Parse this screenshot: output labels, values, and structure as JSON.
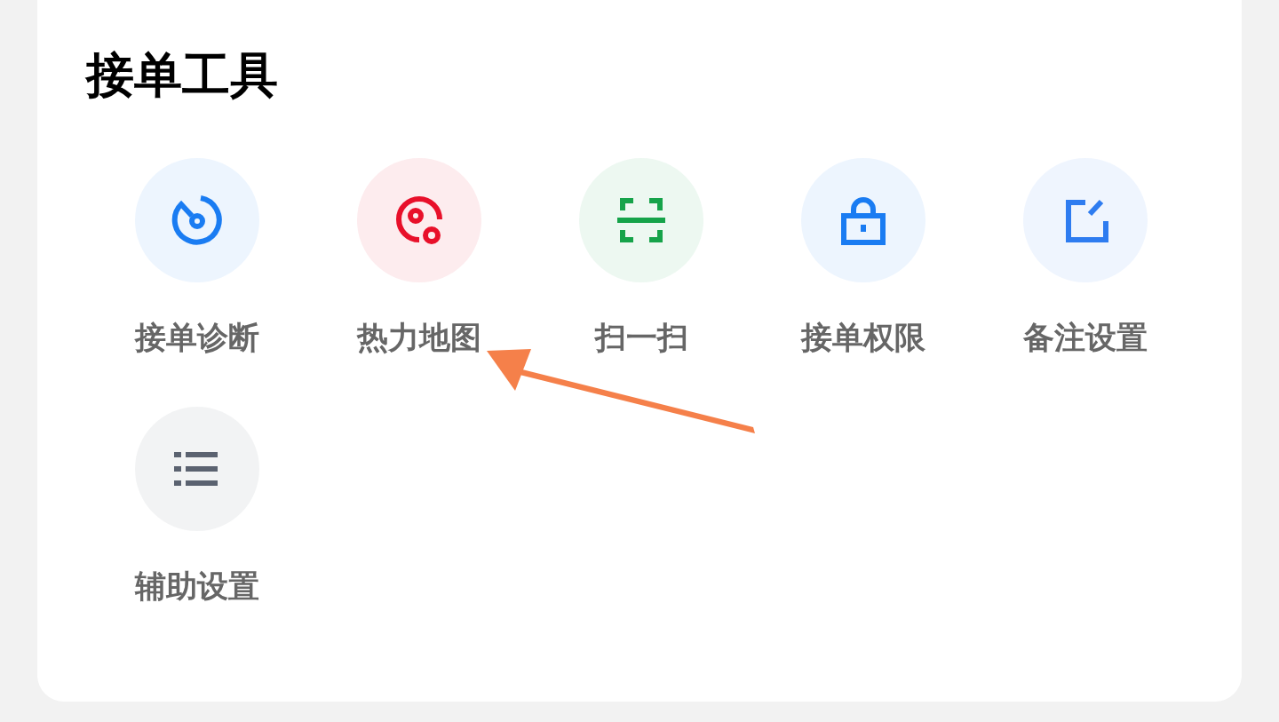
{
  "card": {
    "title": "接单工具",
    "tools": [
      {
        "label": "接单诊断",
        "kind": "gauge",
        "color": "#1a7cf2"
      },
      {
        "label": "热力地图",
        "kind": "target",
        "color": "#e8102a"
      },
      {
        "label": "扫一扫",
        "kind": "scan",
        "color": "#16a34a"
      },
      {
        "label": "接单权限",
        "kind": "lock",
        "color": "#1a7cf2"
      },
      {
        "label": "备注设置",
        "kind": "edit",
        "color": "#2e7cf0"
      },
      {
        "label": "辅助设置",
        "kind": "list",
        "color": "#5b6270"
      }
    ]
  },
  "annotation": {
    "kind": "arrow"
  }
}
